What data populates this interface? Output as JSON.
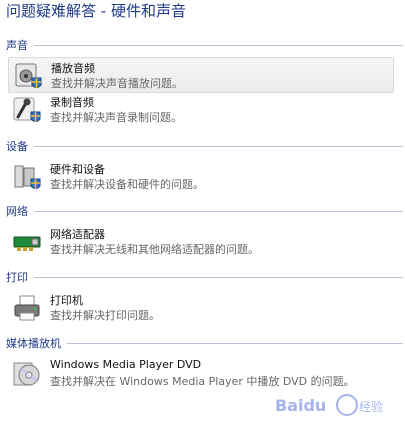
{
  "page": {
    "title": "问题疑难解答 - 硬件和声音"
  },
  "sections": {
    "sound": {
      "label": "声音",
      "items": [
        {
          "title": "播放音频",
          "desc": "查找并解决声音播放问题。",
          "icon": "speaker-shield-icon"
        },
        {
          "title": "录制音频",
          "desc": "查找并解决声音录制问题。",
          "icon": "microphone-shield-icon"
        }
      ]
    },
    "device": {
      "label": "设备",
      "items": [
        {
          "title": "硬件和设备",
          "desc": "查找并解决设备和硬件的问题。",
          "icon": "device-shield-icon"
        }
      ]
    },
    "network": {
      "label": "网络",
      "items": [
        {
          "title": "网络适配器",
          "desc": "查找并解决无线和其他网络适配器的问题。",
          "icon": "network-adapter-icon"
        }
      ]
    },
    "print": {
      "label": "打印",
      "items": [
        {
          "title": "打印机",
          "desc": "查找并解决打印问题。",
          "icon": "printer-icon"
        }
      ]
    },
    "media": {
      "label": "媒体播放机",
      "items": [
        {
          "title": "Windows Media Player DVD",
          "desc": "查找并解决在 Windows Media Player 中播放 DVD 的问题。",
          "icon": "dvd-icon"
        }
      ]
    }
  },
  "watermark": {
    "text": "Baidu 经验"
  }
}
